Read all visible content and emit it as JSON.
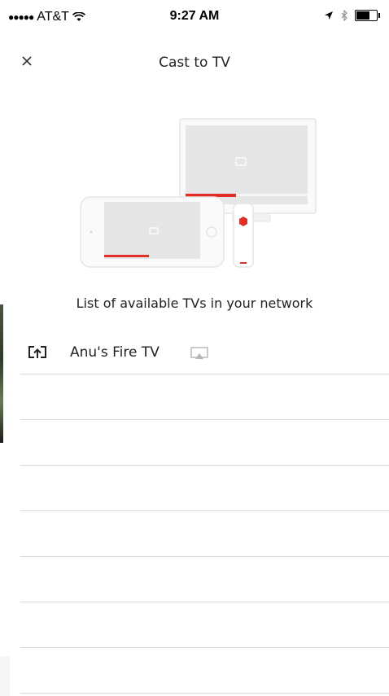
{
  "status_bar": {
    "carrier": "AT&T",
    "time": "9:27 AM"
  },
  "nav": {
    "title": "Cast to TV",
    "close_icon": "close-icon"
  },
  "list_header": "List of available TVs in your network",
  "devices": [
    {
      "name": "Anu's Fire TV",
      "icon": "cast-icon",
      "badge_icon": "airplay-icon"
    }
  ],
  "colors": {
    "accent": "#e52d27",
    "divider": "#dcdcdc",
    "illustration_gray": "#e6e6e6"
  }
}
